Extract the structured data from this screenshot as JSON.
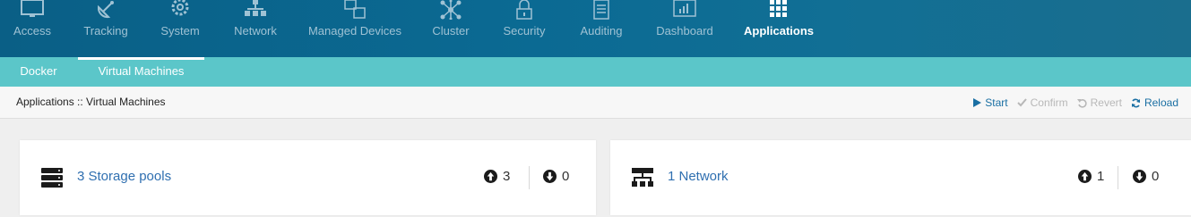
{
  "nav": {
    "items": [
      {
        "label": "Access",
        "icon": "monitor-icon"
      },
      {
        "label": "Tracking",
        "icon": "satellite-dish-icon"
      },
      {
        "label": "System",
        "icon": "gear-icon"
      },
      {
        "label": "Network",
        "icon": "network-tree-icon"
      },
      {
        "label": "Managed Devices",
        "icon": "devices-icon"
      },
      {
        "label": "Cluster",
        "icon": "cluster-icon"
      },
      {
        "label": "Security",
        "icon": "lock-icon"
      },
      {
        "label": "Auditing",
        "icon": "document-icon"
      },
      {
        "label": "Dashboard",
        "icon": "dashboard-icon"
      },
      {
        "label": "Applications",
        "icon": "grid-icon"
      }
    ],
    "active": "Applications"
  },
  "subnav": {
    "tabs": [
      {
        "label": "Docker"
      },
      {
        "label": "Virtual Machines"
      }
    ],
    "active": "Virtual Machines"
  },
  "breadcrumb": {
    "text": "Applications :: Virtual Machines"
  },
  "actions": {
    "start": "Start",
    "confirm": "Confirm",
    "revert": "Revert",
    "reload": "Reload"
  },
  "cards": [
    {
      "label": "3 Storage pools",
      "icon": "server-stack-icon",
      "up": "3",
      "down": "0"
    },
    {
      "label": "1 Network",
      "icon": "network-icon",
      "up": "1",
      "down": "0"
    }
  ],
  "colors": {
    "accent": "#0b6a93",
    "subnav": "#5bc6c9",
    "link": "#2f6fb0"
  }
}
